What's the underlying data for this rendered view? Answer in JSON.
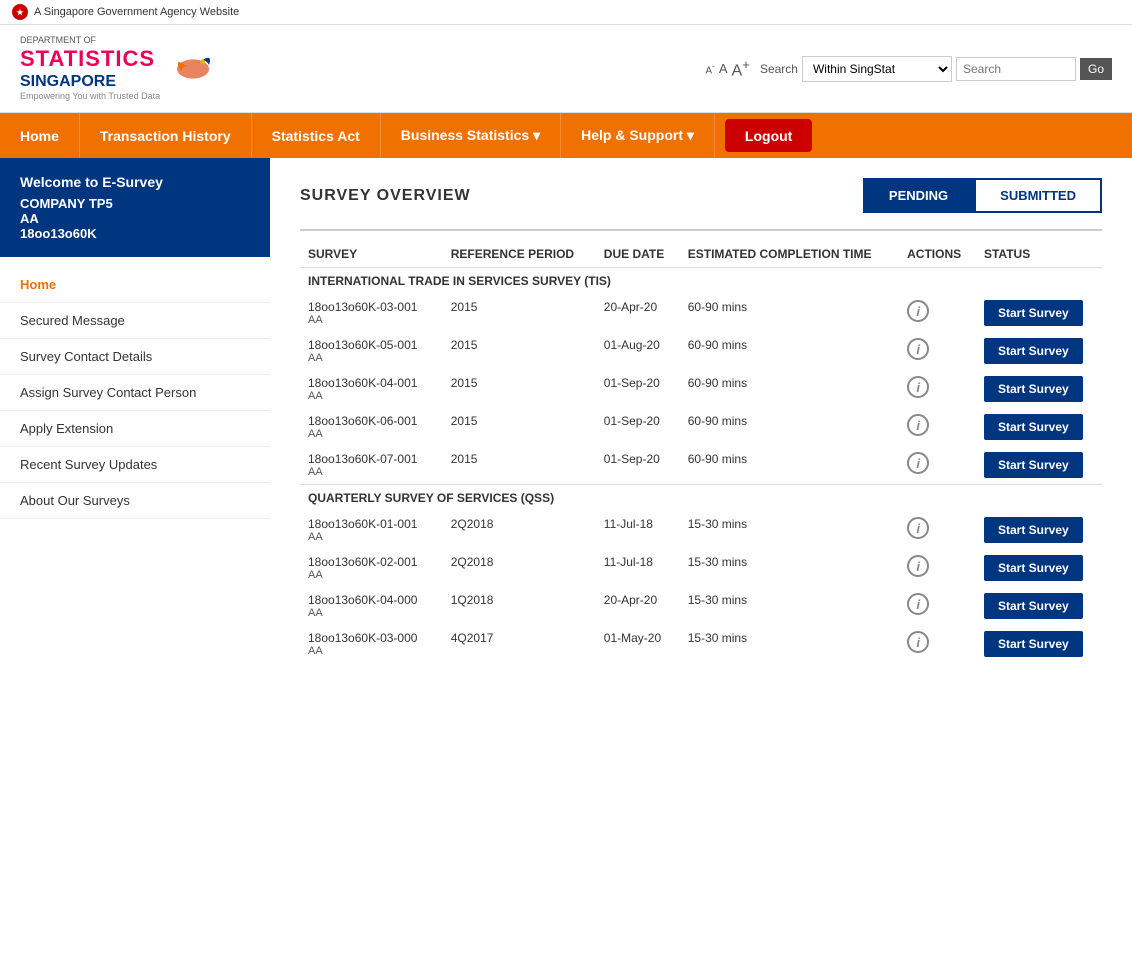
{
  "gov_banner": {
    "text": "A Singapore Government Agency Website"
  },
  "logo": {
    "dept": "DEPARTMENT OF",
    "statistics": "STATISTICS",
    "singapore": "SINGAPORE",
    "tagline": "Empowering You with Trusted Data"
  },
  "font_controls": {
    "small": "A",
    "minus": "-",
    "mid": "A",
    "large": "A",
    "plus": "+"
  },
  "search": {
    "label": "Search",
    "dropdown_value": "Within SingStat",
    "placeholder": "Search",
    "go_label": "Go"
  },
  "nav": {
    "items": [
      {
        "label": "Home",
        "id": "home"
      },
      {
        "label": "Transaction History",
        "id": "transaction-history"
      },
      {
        "label": "Statistics Act",
        "id": "statistics-act"
      },
      {
        "label": "Business Statistics ▾",
        "id": "business-statistics"
      },
      {
        "label": "Help & Support ▾",
        "id": "help-support"
      }
    ],
    "logout_label": "Logout"
  },
  "sidebar": {
    "welcome_title": "Welcome to E-Survey",
    "company": "COMPANY TP5",
    "code_line1": "AA",
    "code_line2": "18oo13o60K",
    "nav_items": [
      {
        "label": "Home",
        "active": true
      },
      {
        "label": "Secured Message",
        "active": false
      },
      {
        "label": "Survey Contact Details",
        "active": false
      },
      {
        "label": "Assign Survey Contact Person",
        "active": false
      },
      {
        "label": "Apply Extension",
        "active": false
      },
      {
        "label": "Recent Survey Updates",
        "active": false
      },
      {
        "label": "About Our Surveys",
        "active": false
      }
    ]
  },
  "content": {
    "survey_overview_title": "SURVEY OVERVIEW",
    "tab_pending": "PENDING",
    "tab_submitted": "SUBMITTED",
    "table_headers": {
      "survey": "SURVEY",
      "reference_period": "REFERENCE PERIOD",
      "due_date": "DUE DATE",
      "estimated_completion_time": "ESTIMATED COMPLETION TIME",
      "actions": "ACTIONS",
      "status": "STATUS"
    },
    "sections": [
      {
        "section_title": "INTERNATIONAL TRADE IN SERVICES SURVEY (TIS)",
        "rows": [
          {
            "ref": "18oo13o60K-03-001",
            "sub": "AA",
            "period": "2015",
            "due_date": "20-Apr-20",
            "completion": "60-90 mins",
            "btn": "Start Survey"
          },
          {
            "ref": "18oo13o60K-05-001",
            "sub": "AA",
            "period": "2015",
            "due_date": "01-Aug-20",
            "completion": "60-90 mins",
            "btn": "Start Survey"
          },
          {
            "ref": "18oo13o60K-04-001",
            "sub": "AA",
            "period": "2015",
            "due_date": "01-Sep-20",
            "completion": "60-90 mins",
            "btn": "Start Survey"
          },
          {
            "ref": "18oo13o60K-06-001",
            "sub": "AA",
            "period": "2015",
            "due_date": "01-Sep-20",
            "completion": "60-90 mins",
            "btn": "Start Survey"
          },
          {
            "ref": "18oo13o60K-07-001",
            "sub": "AA",
            "period": "2015",
            "due_date": "01-Sep-20",
            "completion": "60-90 mins",
            "btn": "Start Survey"
          }
        ]
      },
      {
        "section_title": "QUARTERLY SURVEY OF SERVICES (QSS)",
        "rows": [
          {
            "ref": "18oo13o60K-01-001",
            "sub": "AA",
            "period": "2Q2018",
            "due_date": "11-Jul-18",
            "completion": "15-30 mins",
            "btn": "Start Survey"
          },
          {
            "ref": "18oo13o60K-02-001",
            "sub": "AA",
            "period": "2Q2018",
            "due_date": "11-Jul-18",
            "completion": "15-30 mins",
            "btn": "Start Survey"
          },
          {
            "ref": "18oo13o60K-04-000",
            "sub": "AA",
            "period": "1Q2018",
            "due_date": "20-Apr-20",
            "completion": "15-30 mins",
            "btn": "Start Survey"
          },
          {
            "ref": "18oo13o60K-03-000",
            "sub": "AA",
            "period": "4Q2017",
            "due_date": "01-May-20",
            "completion": "15-30 mins",
            "btn": "Start Survey"
          }
        ]
      }
    ]
  }
}
